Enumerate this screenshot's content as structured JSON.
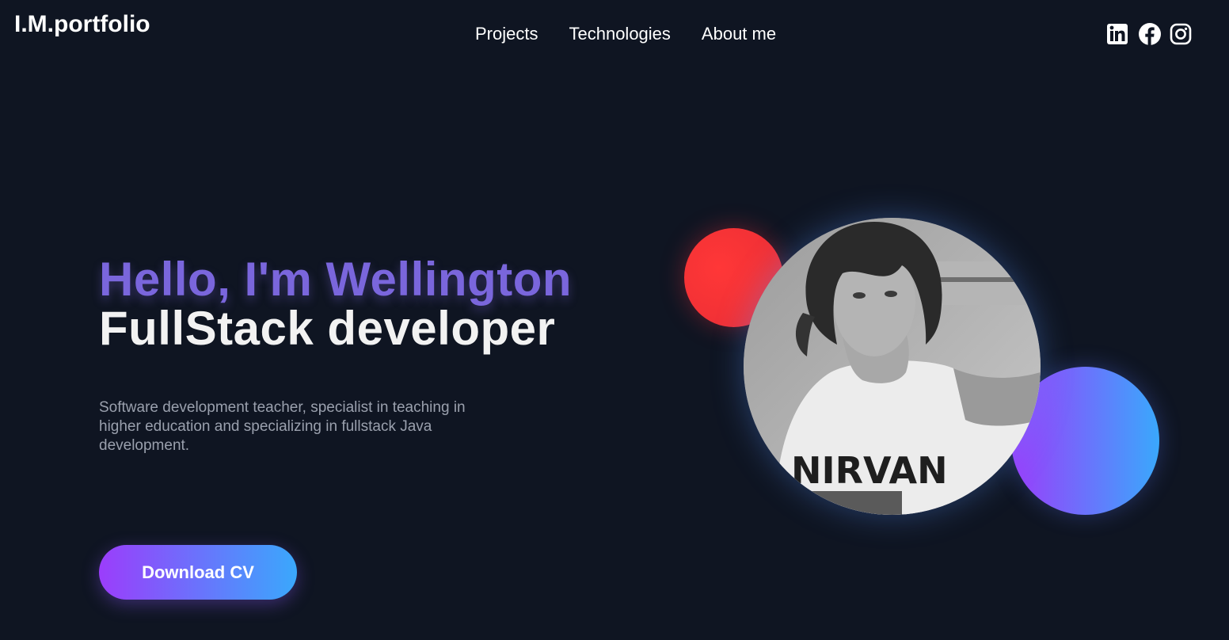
{
  "header": {
    "logo": "I.M.portfolio",
    "nav": [
      {
        "label": "Projects"
      },
      {
        "label": "Technologies"
      },
      {
        "label": "About me"
      }
    ],
    "socials": [
      {
        "icon": "linkedin-icon"
      },
      {
        "icon": "facebook-icon"
      },
      {
        "icon": "instagram-icon"
      }
    ]
  },
  "hero": {
    "greeting": "Hello, I'm Wellington",
    "role": "FullStack developer",
    "description": "Software development teacher, specialist in teaching in higher education and specializing in fullstack Java development.",
    "cta_label": "Download CV",
    "photo_shirt_text": "NIRVAN"
  },
  "colors": {
    "background": "#0f1522",
    "accent_purple": "#7a66dc",
    "gradient_start": "#9b3dfb",
    "gradient_end": "#3aa8fc",
    "red_circle": "#f23136",
    "description_text": "#9aa0ad"
  }
}
